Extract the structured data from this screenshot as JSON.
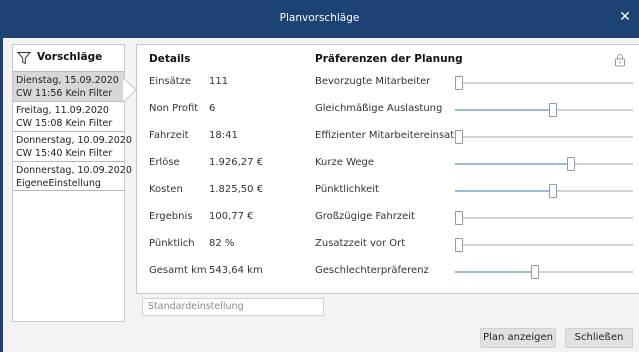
{
  "window": {
    "title": "Planvorschläge",
    "close_glyph": "✕"
  },
  "suggestions": {
    "header": "Vorschläge",
    "icon": "filter-icon",
    "items": [
      {
        "line1": "Dienstag, 15.09.2020",
        "line2": "CW 11:56 Kein Filter",
        "selected": true
      },
      {
        "line1": "Freitag, 11.09.2020",
        "line2": "CW 15:08 Kein Filter",
        "selected": false
      },
      {
        "line1": "Donnerstag, 10.09.2020",
        "line2": "CW 15:40 Kein Filter",
        "selected": false
      },
      {
        "line1": "Donnerstag, 10.09.2020",
        "line2": "EigeneEinstellung",
        "selected": false
      }
    ]
  },
  "details": {
    "title": "Details",
    "rows": [
      {
        "label": "Einsätze",
        "value": "111"
      },
      {
        "label": "Non Profit",
        "value": "6"
      },
      {
        "label": "Fahrzeit",
        "value": "18:41"
      },
      {
        "label": "Erlöse",
        "value": "1.926,27 €"
      },
      {
        "label": "Kosten",
        "value": "1.825,50 €"
      },
      {
        "label": "Ergebnis",
        "value": "100,77 €"
      },
      {
        "label": "Pünktlich",
        "value": "82 %"
      },
      {
        "label": "Gesamt km",
        "value": "543,64 km"
      }
    ]
  },
  "preferences": {
    "title": "Präferenzen der Planung",
    "lock_icon": "lock-icon",
    "items": [
      {
        "label": "Bevorzugte Mitarbeiter",
        "level": 0.0
      },
      {
        "label": "Gleichmäßige Auslastung",
        "level": 0.55
      },
      {
        "label": "Effizienter Mitarbeitereinsatz",
        "level": 0.0
      },
      {
        "label": "Kurze Wege",
        "level": 0.65
      },
      {
        "label": "Pünktlichkeit",
        "level": 0.55
      },
      {
        "label": "Großzügige Fahrzeit",
        "level": 0.0
      },
      {
        "label": "Zusatzzeit vor Ort",
        "level": 0.0
      },
      {
        "label": "Geschlechterpräferenz",
        "level": 0.45
      }
    ]
  },
  "settings_input": {
    "placeholder": "Standardeinstellung",
    "value": ""
  },
  "buttons": {
    "show_plan": "Plan anzeigen",
    "close": "Schließen"
  },
  "colors": {
    "titlebar": "#1d4274",
    "slider_fill": "#9fb9d6",
    "selected_item": "#d7d7d7"
  }
}
